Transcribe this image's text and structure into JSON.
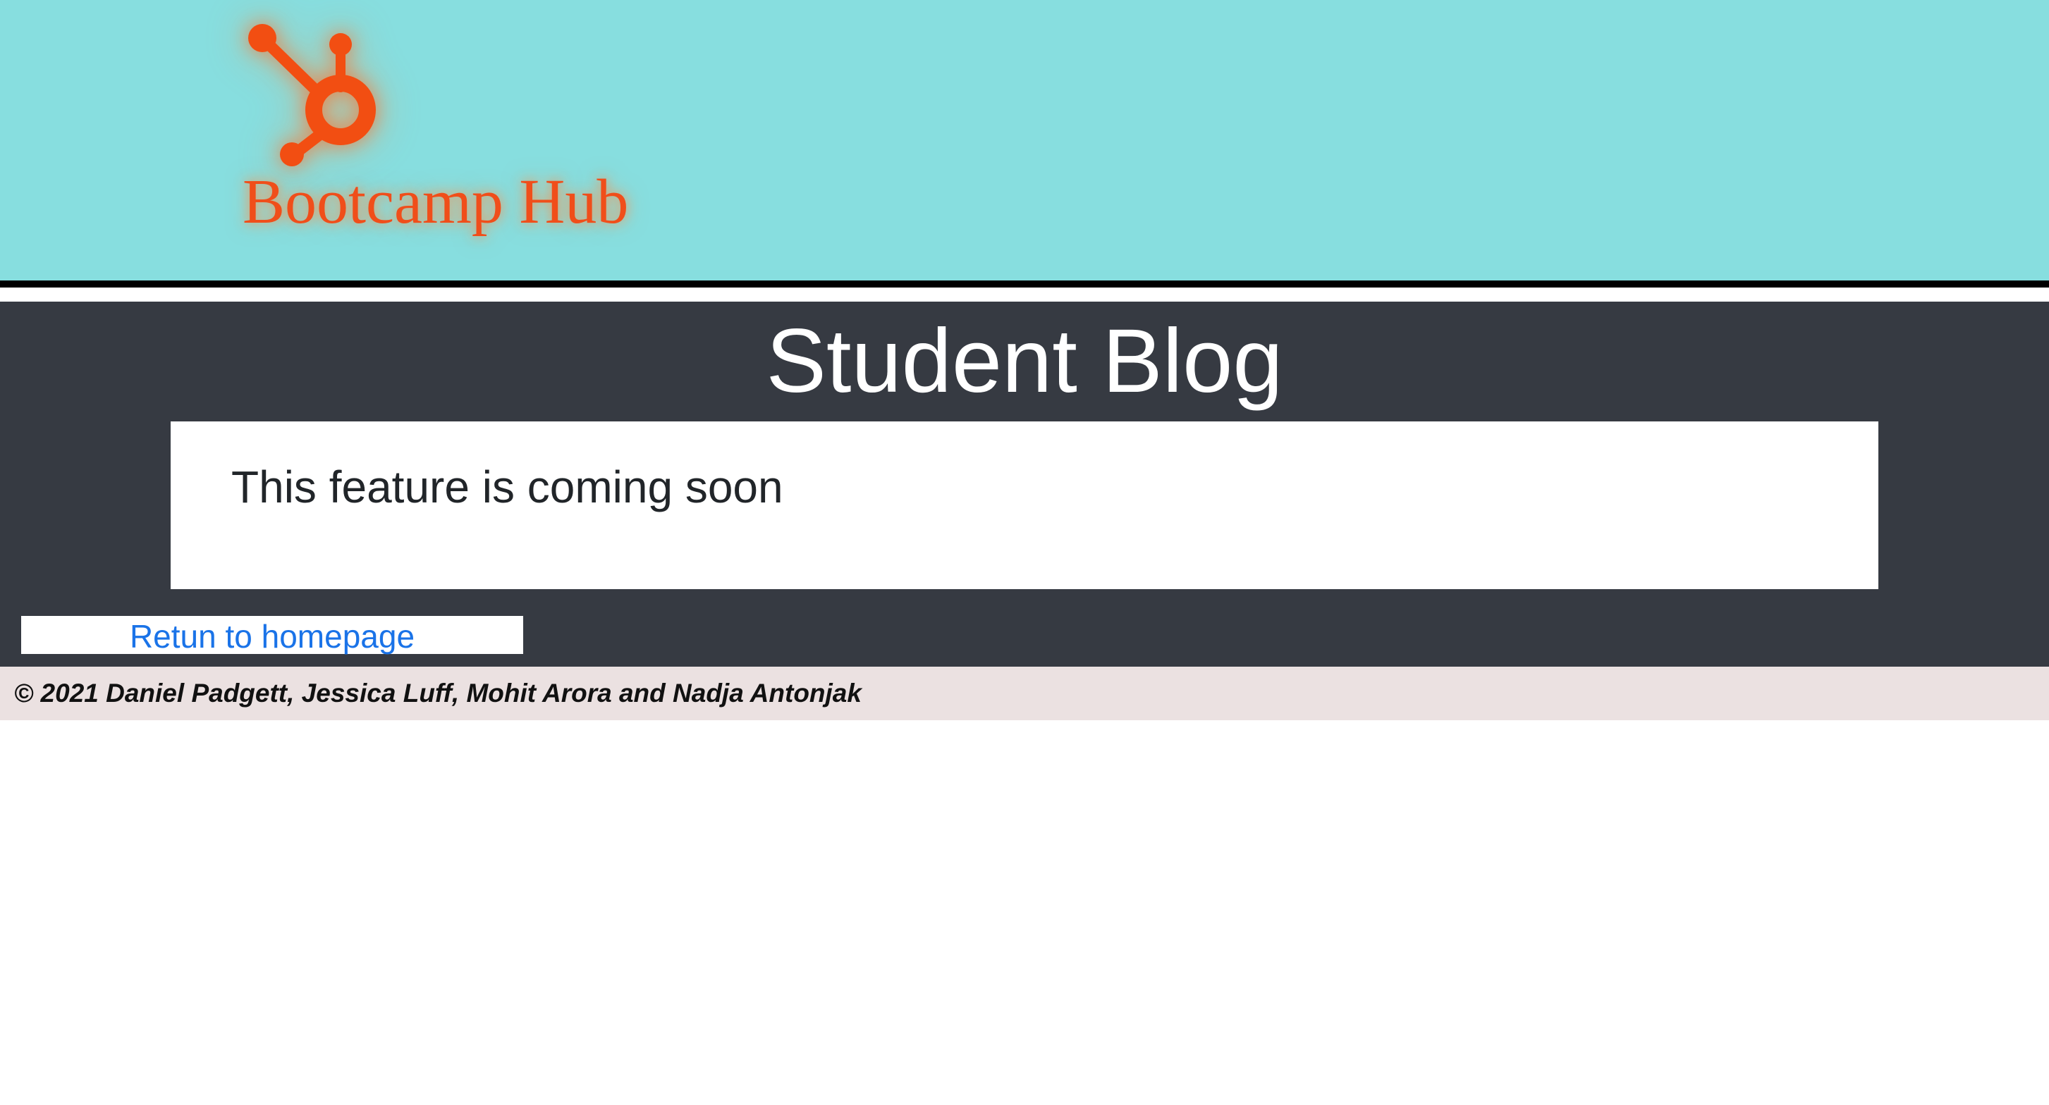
{
  "header": {
    "logo_text": "Bootcamp Hub",
    "logo_icon": "hubspot-sprocket-icon",
    "background_color": "#87dedf",
    "brand_color": "#f04e1a"
  },
  "main": {
    "title": "Student Blog",
    "message": "This feature is coming soon",
    "home_link_label": "Retun to homepage",
    "background_color": "#363a42"
  },
  "footer": {
    "copyright": "© 2021 Daniel Padgett, Jessica Luff, Mohit Arora and Nadja Antonjak",
    "background_color": "#ebe1e1"
  }
}
